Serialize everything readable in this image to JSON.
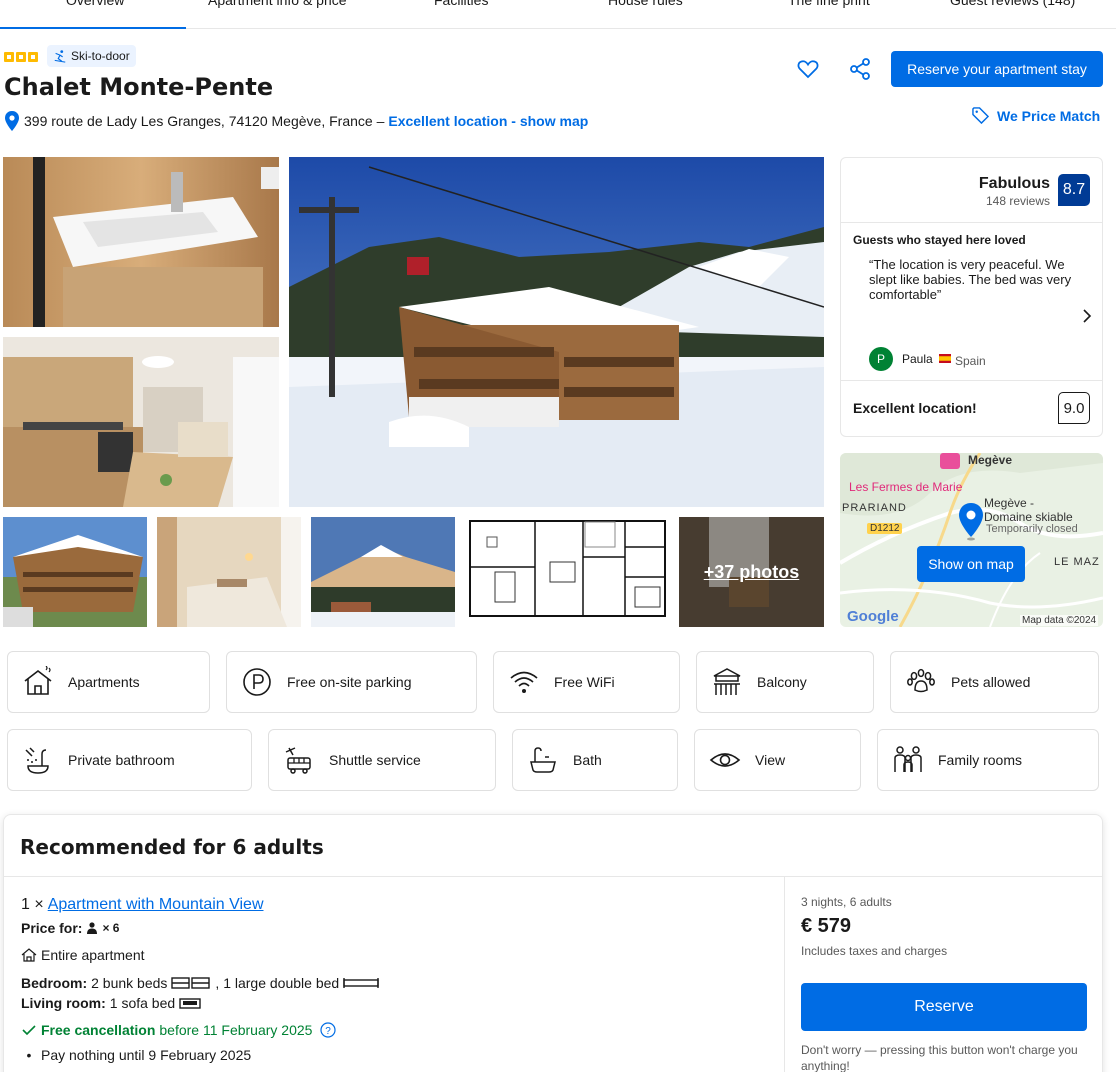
{
  "tabs": [
    "Overview",
    "Apartment info & price",
    "Facilities",
    "House rules",
    "The fine print",
    "Guest reviews (148)"
  ],
  "header": {
    "badge": "Ski-to-door",
    "title": "Chalet Monte-Pente",
    "address": "399 route de Lady Les Granges, 74120 Megève, France –",
    "location_link": "Excellent location - show map",
    "reserve_label": "Reserve your apartment stay",
    "price_match": "We Price Match"
  },
  "gallery": {
    "more_photos": "+37 photos"
  },
  "review": {
    "label": "Fabulous",
    "count": "148 reviews",
    "score": "8.7",
    "loved_heading": "Guests who stayed here loved",
    "quote": "“The location is very peaceful. We slept like babies. The bed was very comfortable”",
    "reviewer_initial": "P",
    "reviewer_name": "Paula",
    "reviewer_country": "Spain",
    "location_label": "Excellent location!",
    "location_score": "9.0"
  },
  "map": {
    "button": "Show on map",
    "labels": {
      "megeve": "Megève",
      "fermes": "Les Fermes de Marie",
      "prariand": "PRARIAND",
      "road": "D1212",
      "domaine1": "Megève -",
      "domaine2": "Domaine skiable",
      "closed": "Temporarily closed",
      "lemaz": "LE MAZ",
      "google": "Google",
      "mapdata": "Map data ©2024"
    }
  },
  "facilities": [
    {
      "label": "Apartments",
      "icon": "house-icon"
    },
    {
      "label": "Free on-site parking",
      "icon": "parking-icon"
    },
    {
      "label": "Free WiFi",
      "icon": "wifi-icon"
    },
    {
      "label": "Balcony",
      "icon": "balcony-icon"
    },
    {
      "label": "Pets allowed",
      "icon": "paw-icon"
    },
    {
      "label": "Private bathroom",
      "icon": "shower-icon"
    },
    {
      "label": "Shuttle service",
      "icon": "shuttle-icon"
    },
    {
      "label": "Bath",
      "icon": "bath-icon"
    },
    {
      "label": "View",
      "icon": "eye-icon"
    },
    {
      "label": "Family rooms",
      "icon": "family-icon"
    }
  ],
  "recommended": {
    "title": "Recommended for 6 adults",
    "quantity": "1 ×",
    "apartment_link": "Apartment with Mountain View",
    "price_for_label": "Price for:",
    "price_for_count": "× 6",
    "entire": "Entire apartment",
    "bedroom_label": "Bedroom:",
    "bedroom_value": "2 bunk beds",
    "bedroom_value2": ", 1 large double bed",
    "living_label": "Living room:",
    "living_value": "1 sofa bed",
    "free_cancel": "Free cancellation",
    "cancel_date": "before 11 February 2025",
    "pay_nothing": "Pay nothing until 9 February 2025",
    "nights": "3 nights, 6 adults",
    "price": "€ 579",
    "taxes": "Includes taxes and charges",
    "reserve": "Reserve",
    "worry": "Don't worry — pressing this button won't charge you anything!"
  },
  "colors": {
    "accent": "#006ce4",
    "score_bg": "#003b95",
    "star": "#febb02",
    "green": "#008234"
  }
}
